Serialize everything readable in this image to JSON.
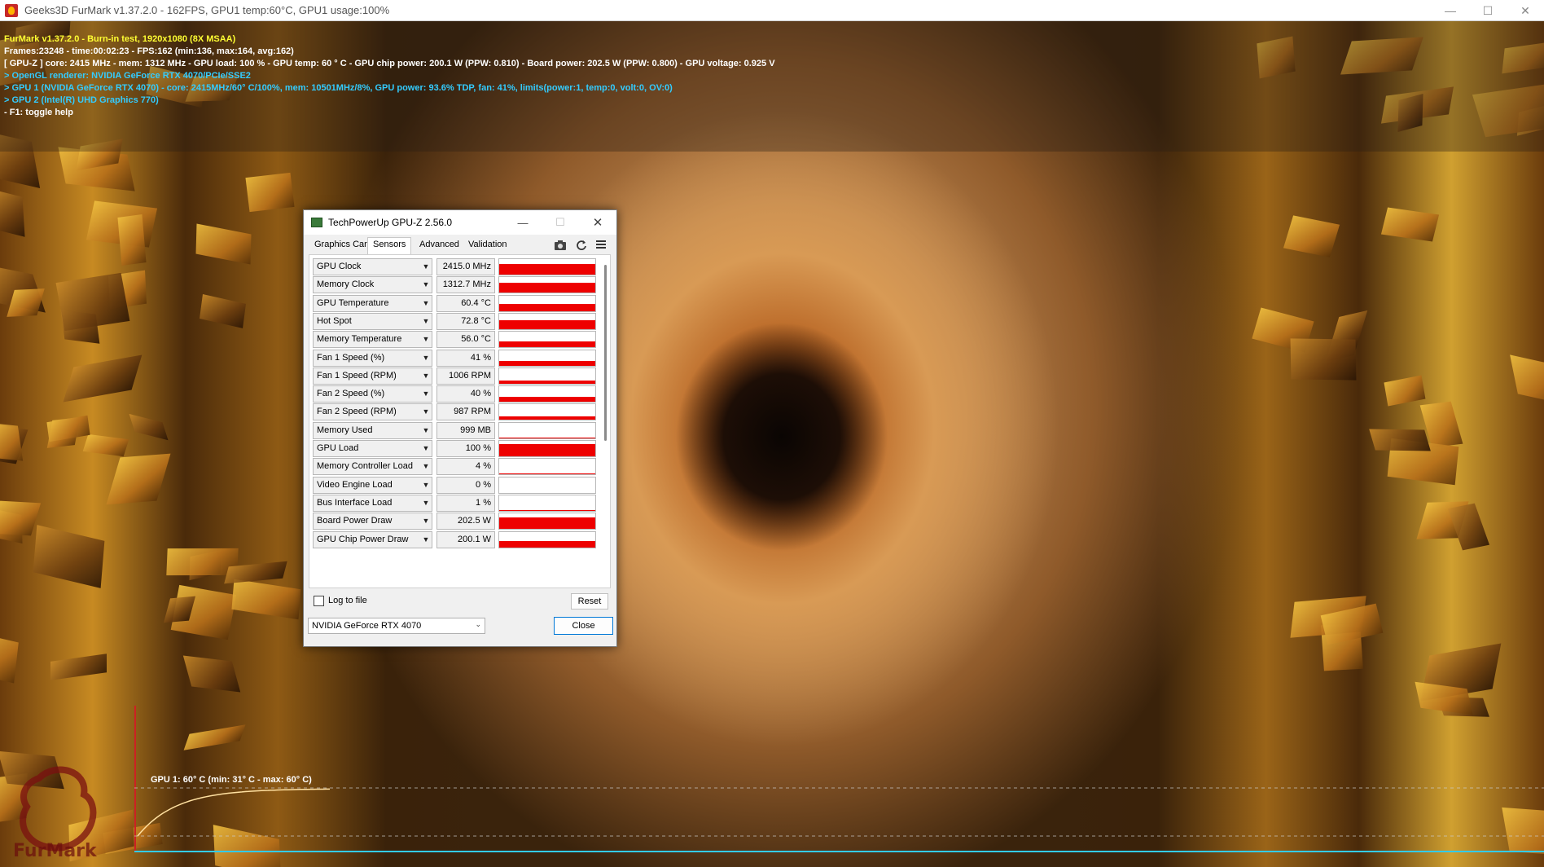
{
  "furmark_window": {
    "title": "Geeks3D FurMark v1.37.2.0 - 162FPS, GPU1 temp:60°C, GPU1 usage:100%"
  },
  "hud": {
    "line1": "FurMark v1.37.2.0 - Burn-in test, 1920x1080 (8X MSAA)",
    "line2": "Frames:23248 - time:00:02:23 - FPS:162 (min:136, max:164, avg:162)",
    "line3": "[ GPU-Z ] core: 2415 MHz - mem: 1312 MHz - GPU load: 100 % - GPU temp: 60 ° C - GPU chip power: 200.1 W (PPW: 0.810) - Board power: 202.5 W (PPW: 0.800) - GPU voltage: 0.925 V",
    "line4": "> OpenGL renderer: NVIDIA GeForce RTX 4070/PCIe/SSE2",
    "line5": "> GPU 1 (NVIDIA GeForce RTX 4070) - core: 2415MHz/60° C/100%, mem: 10501MHz/8%, GPU power: 93.6% TDP, fan: 41%, limits(power:1, temp:0, volt:0, OV:0)",
    "line6": "> GPU 2 (Intel(R) UHD Graphics 770)",
    "line7": "- F1: toggle help",
    "colors": {
      "yellow": "#ffff33",
      "white": "#ffffff",
      "cyan": "#33ccff"
    }
  },
  "temp_graph": {
    "label": "GPU 1: 60° C (min: 31° C - max: 60° C)",
    "line_color": "#ffe0a0",
    "axis_color": "#33ccff"
  },
  "gpuz": {
    "title": "TechPowerUp GPU-Z 2.56.0",
    "tabs": [
      "Graphics Card",
      "Sensors",
      "Advanced",
      "Validation"
    ],
    "active_tab": "Sensors",
    "sensors": [
      {
        "name": "GPU Clock",
        "value": "2415.0 MHz",
        "level": 0.68
      },
      {
        "name": "Memory Clock",
        "value": "1312.7 MHz",
        "level": 0.62
      },
      {
        "name": "GPU Temperature",
        "value": "60.4 °C",
        "level": 0.48
      },
      {
        "name": "Hot Spot",
        "value": "72.8 °C",
        "level": 0.58
      },
      {
        "name": "Memory Temperature",
        "value": "56.0 °C",
        "level": 0.38
      },
      {
        "name": "Fan 1 Speed (%)",
        "value": "41 %",
        "level": 0.3
      },
      {
        "name": "Fan 1 Speed (RPM)",
        "value": "1006 RPM",
        "level": 0.2
      },
      {
        "name": "Fan 2 Speed (%)",
        "value": "40 %",
        "level": 0.3
      },
      {
        "name": "Fan 2 Speed (RPM)",
        "value": "987 RPM",
        "level": 0.2
      },
      {
        "name": "Memory Used",
        "value": "999 MB",
        "level": 0.05
      },
      {
        "name": "GPU Load",
        "value": "100 %",
        "level": 0.78
      },
      {
        "name": "Memory Controller Load",
        "value": "4 %",
        "level": 0.06
      },
      {
        "name": "Video Engine Load",
        "value": "0 %",
        "level": 0
      },
      {
        "name": "Bus Interface Load",
        "value": "1 %",
        "level": 0.02
      },
      {
        "name": "Board Power Draw",
        "value": "202.5 W",
        "level": 0.72
      },
      {
        "name": "GPU Chip Power Draw",
        "value": "200.1 W",
        "level": 0.4
      }
    ],
    "log_to_file_label": "Log to file",
    "reset_label": "Reset",
    "device": "NVIDIA GeForce RTX 4070",
    "close_label": "Close",
    "bar_color": "#ee0000"
  }
}
